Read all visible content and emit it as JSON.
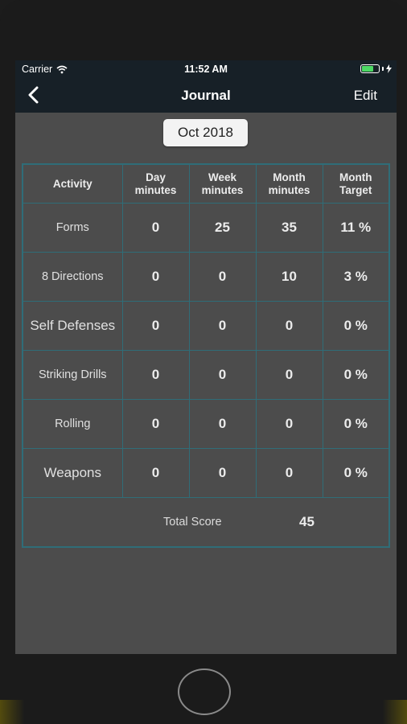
{
  "status_bar": {
    "carrier": "Carrier",
    "time": "11:52 AM",
    "battery_level": 0.62
  },
  "nav": {
    "back_icon": "chevron-left-icon",
    "title": "Journal",
    "edit_label": "Edit"
  },
  "month_selector": {
    "label": "Oct 2018"
  },
  "table": {
    "headers": [
      "Activity",
      "Day minutes",
      "Week minutes",
      "Month minutes",
      "Month Target"
    ],
    "rows": [
      {
        "activity": "Forms",
        "day": "0",
        "week": "25",
        "month": "35",
        "target": "11 %"
      },
      {
        "activity": "8 Directions",
        "day": "0",
        "week": "0",
        "month": "10",
        "target": "3 %"
      },
      {
        "activity": "Self Defenses",
        "day": "0",
        "week": "0",
        "month": "0",
        "target": "0 %"
      },
      {
        "activity": "Striking Drills",
        "day": "0",
        "week": "0",
        "month": "0",
        "target": "0 %"
      },
      {
        "activity": "Rolling",
        "day": "0",
        "week": "0",
        "month": "0",
        "target": "0 %"
      },
      {
        "activity": "Weapons",
        "day": "0",
        "week": "0",
        "month": "0",
        "target": "0 %"
      }
    ],
    "total_label": "Total Score",
    "total_value": "45"
  },
  "colors": {
    "bar_bg": "#172027",
    "screen_bg": "#4c4c4c",
    "grid_line": "#2f6d78",
    "battery_green": "#4cd964"
  }
}
